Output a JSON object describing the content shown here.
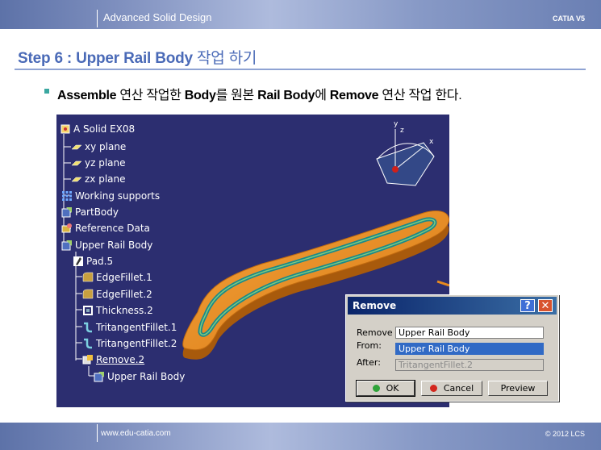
{
  "header": {
    "title": "Advanced Solid Design",
    "brand": "CATIA V5"
  },
  "step": {
    "prefix": "Step 6 : Upper Rail Body",
    "suffix": " 작업 하기"
  },
  "instruction": {
    "p1": "Assemble",
    "p2": " 연산 작업한 ",
    "p3": "Body",
    "p4": "를 원본 ",
    "p5": "Rail Body",
    "p6": "에 ",
    "p7": "Remove",
    "p8": " 연산 작업 한다."
  },
  "tree": [
    {
      "label": "A Solid EX08",
      "icon": "part-icon"
    },
    {
      "label": "xy plane",
      "icon": "plane-icon"
    },
    {
      "label": "yz plane",
      "icon": "plane-icon"
    },
    {
      "label": "zx plane",
      "icon": "plane-icon"
    },
    {
      "label": "Working supports",
      "icon": "grid-icon"
    },
    {
      "label": "PartBody",
      "icon": "body-icon"
    },
    {
      "label": "Reference Data",
      "icon": "geoset-icon"
    },
    {
      "label": "Upper Rail Body",
      "icon": "body-icon"
    },
    {
      "label": "Pad.5",
      "icon": "pad-icon"
    },
    {
      "label": "EdgeFillet.1",
      "icon": "fillet-icon"
    },
    {
      "label": "EdgeFillet.2",
      "icon": "fillet-icon"
    },
    {
      "label": "Thickness.2",
      "icon": "thickness-icon"
    },
    {
      "label": "TritangentFillet.1",
      "icon": "tritangent-icon"
    },
    {
      "label": "TritangentFillet.2",
      "icon": "tritangent-icon"
    },
    {
      "label": "Remove.2",
      "icon": "remove-icon"
    },
    {
      "label": "Upper Rail Body",
      "icon": "body-icon"
    }
  ],
  "compass": {
    "x": "x",
    "y": "y",
    "z": "z"
  },
  "dialog": {
    "title": "Remove",
    "help": "?",
    "close": "✕",
    "remove_label": "Remove",
    "remove_value": "Upper Rail Body",
    "from_label": "From:",
    "from_value": "Upper Rail Body",
    "after_label": "After:",
    "after_value": "TritangentFillet.2",
    "ok": "OK",
    "cancel": "Cancel",
    "preview": "Preview"
  },
  "footer": {
    "url": "www.edu-catia.com",
    "copyright": "© 2012 LCS"
  },
  "colors": {
    "accent": "#4a6ab7",
    "viewport_bg": "#2c2e70",
    "part_orange": "#e88a1e",
    "selection": "#316ac5"
  }
}
